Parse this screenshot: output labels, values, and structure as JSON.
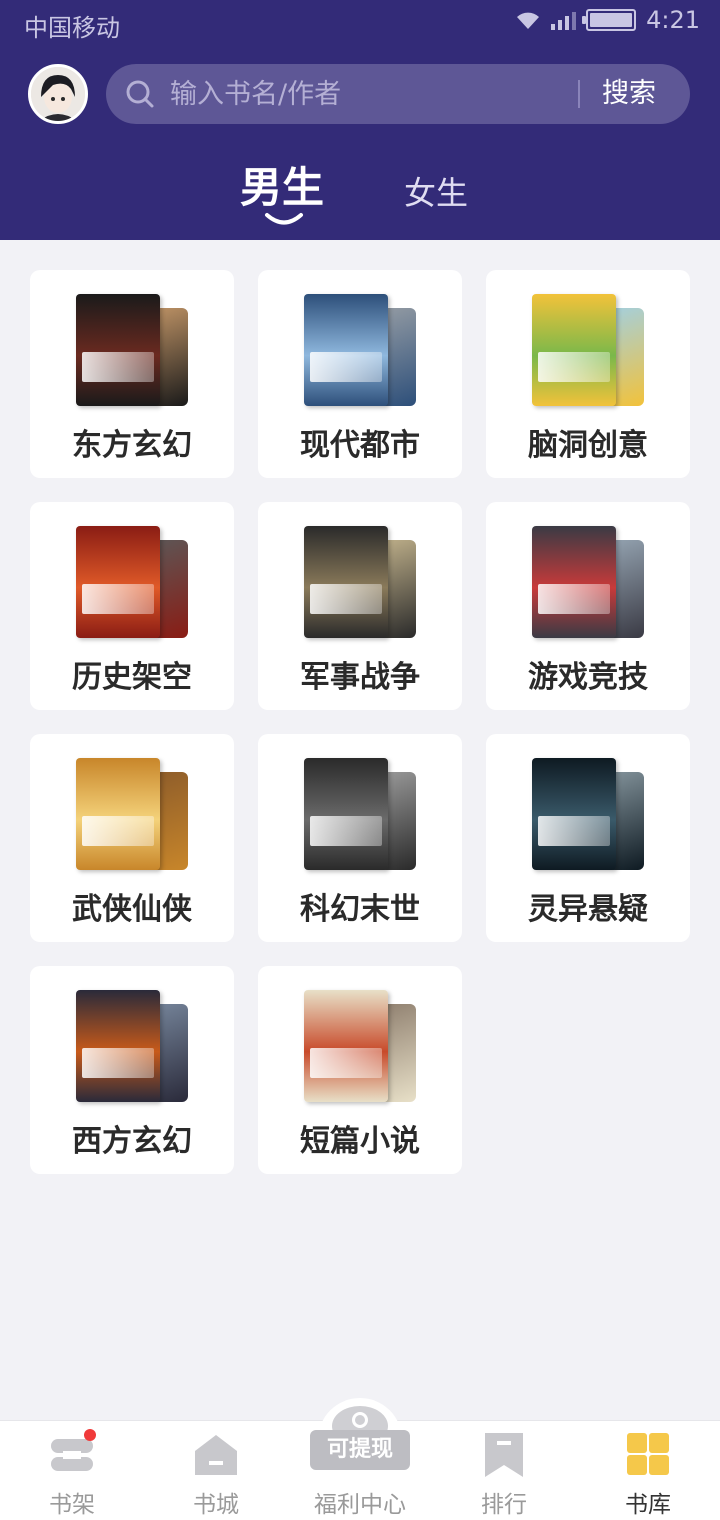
{
  "status_bar": {
    "carrier": "中国移动",
    "time": "4:21"
  },
  "search": {
    "placeholder": "输入书名/作者",
    "button_label": "搜索"
  },
  "tabs": {
    "male": "男生",
    "female": "女生",
    "active": "male"
  },
  "categories": [
    {
      "label": "东方玄幻",
      "cover_colors": [
        "#1a1a1a",
        "#6b2a20",
        "#c89a6a"
      ]
    },
    {
      "label": "现代都市",
      "cover_colors": [
        "#2d4f7a",
        "#8fb8de",
        "#9aa0a6"
      ]
    },
    {
      "label": "脑洞创意",
      "cover_colors": [
        "#f2c23a",
        "#7ab84a",
        "#9fd0e8"
      ]
    },
    {
      "label": "历史架空",
      "cover_colors": [
        "#8a1c14",
        "#e05a28",
        "#5a5a5a"
      ]
    },
    {
      "label": "军事战争",
      "cover_colors": [
        "#2a2a2a",
        "#8a7a5a",
        "#c8b890"
      ]
    },
    {
      "label": "游戏竞技",
      "cover_colors": [
        "#3a3a44",
        "#c83a3a",
        "#9aaab8"
      ]
    },
    {
      "label": "武侠仙侠",
      "cover_colors": [
        "#c8862a",
        "#f4d27a",
        "#8a5a2a"
      ]
    },
    {
      "label": "科幻末世",
      "cover_colors": [
        "#2a2a2a",
        "#6a6a6a",
        "#a0a0a0"
      ]
    },
    {
      "label": "灵异悬疑",
      "cover_colors": [
        "#0e1a22",
        "#3a5a6a",
        "#8a9aa2"
      ]
    },
    {
      "label": "西方玄幻",
      "cover_colors": [
        "#2a2a3a",
        "#c85a1a",
        "#7a8aa0"
      ]
    },
    {
      "label": "短篇小说",
      "cover_colors": [
        "#e8e0c8",
        "#c84a2a",
        "#8a7a6a"
      ]
    }
  ],
  "welfare_badge": "可提现",
  "bottom_nav": [
    {
      "label": "书架",
      "icon": "bookshelf-icon",
      "active": false,
      "has_dot": true
    },
    {
      "label": "书城",
      "icon": "bookstore-icon",
      "active": false,
      "has_dot": false
    },
    {
      "label": "福利中心",
      "icon": "welfare-icon",
      "active": false,
      "has_dot": false
    },
    {
      "label": "排行",
      "icon": "ranking-icon",
      "active": false,
      "has_dot": false
    },
    {
      "label": "书库",
      "icon": "library-icon",
      "active": true,
      "has_dot": false
    }
  ],
  "colors": {
    "header": "#332b78",
    "search_box": "#5e5796",
    "active_nav": "#f5c84a",
    "inactive_nav": "#c8c8cc"
  }
}
